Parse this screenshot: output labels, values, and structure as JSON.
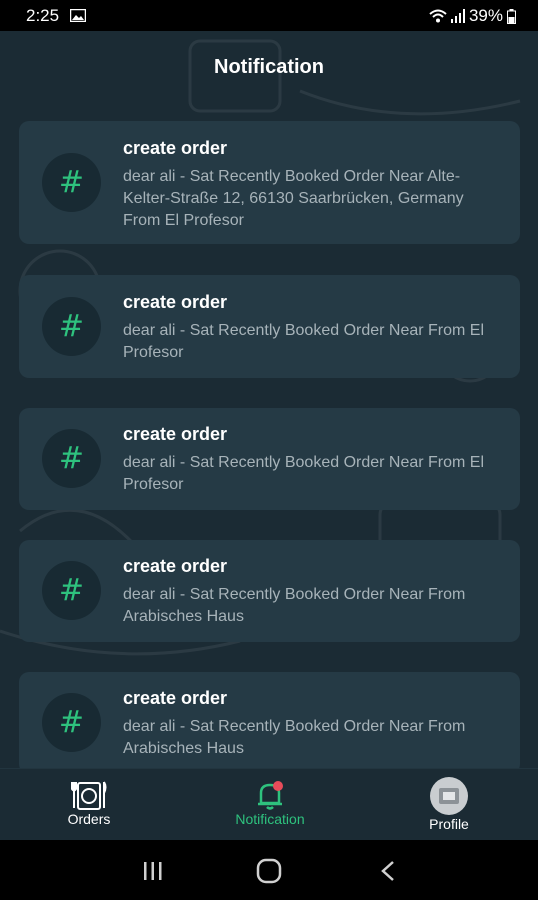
{
  "status": {
    "time": "2:25",
    "battery": "39%"
  },
  "header": {
    "title": "Notification"
  },
  "notifications": [
    {
      "icon": "#",
      "title": "create order",
      "body": "dear ali - Sat Recently Booked Order Near Alte-Kelter-Straße 12, 66130 Saarbrücken, Germany From El Profesor"
    },
    {
      "icon": "#",
      "title": "create order",
      "body": "dear ali - Sat Recently Booked Order Near From El Profesor"
    },
    {
      "icon": "#",
      "title": "create order",
      "body": "dear ali - Sat Recently Booked Order Near From El Profesor"
    },
    {
      "icon": "#",
      "title": "create order",
      "body": "dear ali - Sat Recently Booked Order Near From Arabisches Haus"
    },
    {
      "icon": "#",
      "title": "create order",
      "body": "dear ali - Sat Recently Booked Order Near From Arabisches Haus"
    }
  ],
  "nav": {
    "orders": {
      "label": "Orders",
      "icon": "restaurant-menu-icon"
    },
    "notification": {
      "label": "Notification",
      "icon": "bell-icon",
      "active_color": "#2ec27e"
    },
    "profile": {
      "label": "Profile",
      "icon": "avatar-icon"
    }
  },
  "colors": {
    "background": "#1b2b34",
    "card": "#253a45",
    "accent": "#2ec27e"
  }
}
